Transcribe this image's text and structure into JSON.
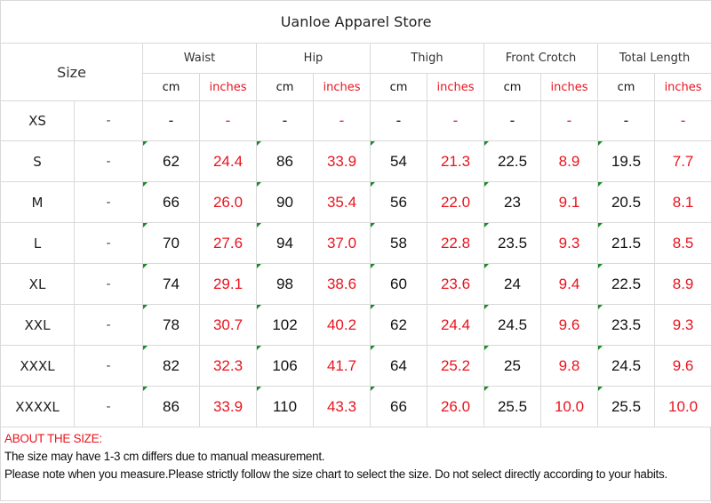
{
  "title": "Uanloe Apparel Store",
  "size_label": "Size",
  "measurements": [
    "Waist",
    "Hip",
    "Thigh",
    "Front Crotch",
    "Total Length"
  ],
  "units": {
    "cm": "cm",
    "inches": "inches"
  },
  "colors": {
    "inches": "#e8141e",
    "grid": "#d9d9d9",
    "marker": "#1a8a2a"
  },
  "rows": [
    {
      "size": "XS",
      "extra": "-",
      "values": [
        "-",
        "-",
        "-",
        "-",
        "-",
        "-",
        "-",
        "-",
        "-",
        "-"
      ]
    },
    {
      "size": "S",
      "extra": "-",
      "values": [
        "62",
        "24.4",
        "86",
        "33.9",
        "54",
        "21.3",
        "22.5",
        "8.9",
        "19.5",
        "7.7"
      ]
    },
    {
      "size": "M",
      "extra": "-",
      "values": [
        "66",
        "26.0",
        "90",
        "35.4",
        "56",
        "22.0",
        "23",
        "9.1",
        "20.5",
        "8.1"
      ]
    },
    {
      "size": "L",
      "extra": "-",
      "values": [
        "70",
        "27.6",
        "94",
        "37.0",
        "58",
        "22.8",
        "23.5",
        "9.3",
        "21.5",
        "8.5"
      ]
    },
    {
      "size": "XL",
      "extra": "-",
      "values": [
        "74",
        "29.1",
        "98",
        "38.6",
        "60",
        "23.6",
        "24",
        "9.4",
        "22.5",
        "8.9"
      ]
    },
    {
      "size": "XXL",
      "extra": "-",
      "values": [
        "78",
        "30.7",
        "102",
        "40.2",
        "62",
        "24.4",
        "24.5",
        "9.6",
        "23.5",
        "9.3"
      ]
    },
    {
      "size": "XXXL",
      "extra": "-",
      "values": [
        "82",
        "32.3",
        "106",
        "41.7",
        "64",
        "25.2",
        "25",
        "9.8",
        "24.5",
        "9.6"
      ]
    },
    {
      "size": "XXXXL",
      "extra": "-",
      "values": [
        "86",
        "33.9",
        "110",
        "43.3",
        "66",
        "26.0",
        "25.5",
        "10.0",
        "25.5",
        "10.0"
      ]
    }
  ],
  "notes": {
    "heading": "ABOUT THE SIZE:",
    "line1": "The size may have 1-3 cm differs due to manual measurement.",
    "line2": "Please note when you measure.Please strictly follow the size chart  to select the size. Do not select directly according to your habits."
  }
}
